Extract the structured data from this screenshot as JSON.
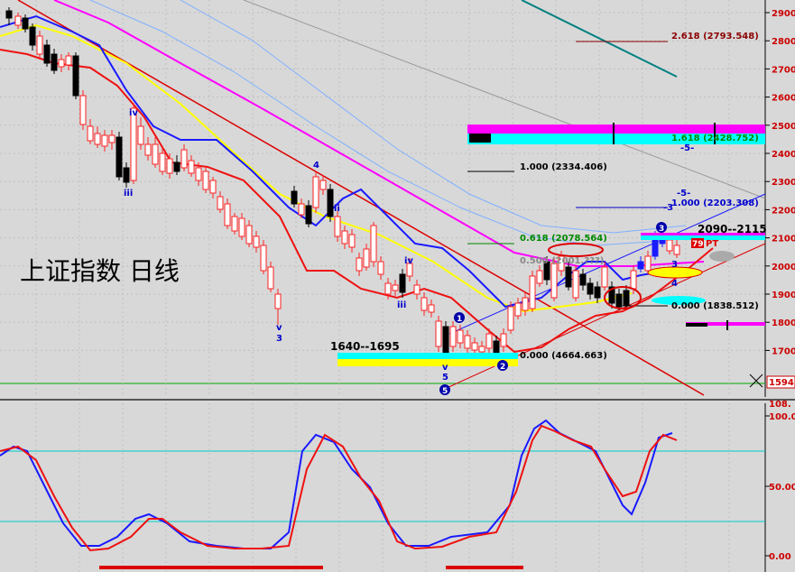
{
  "title": "上证指数 日线",
  "colors": {
    "bg": "#d8d8d8",
    "up": "#ff2020",
    "down": "#000000",
    "ma_blue": "#1a1aff",
    "ma_red": "#ee1111",
    "ma_magenta": "#ff00ff",
    "ma_yellow": "#ffff00",
    "osc_blue": "#1a1aff",
    "osc_red": "#ee1111"
  },
  "price_axis": {
    "ticks": [
      "2900.",
      "2800.",
      "2700.",
      "2600.",
      "2500.",
      "2400.",
      "2300.",
      "2200.",
      "2100.",
      "2000.",
      "1900.",
      "1800.",
      "1700."
    ],
    "last_value": "1594."
  },
  "osc_axis": {
    "ticks": [
      "100.0",
      "50.00",
      "0.00"
    ],
    "top_value": "108."
  },
  "fib_labels": [
    {
      "text": "2.618 (2793.548)",
      "color": "#8b0000"
    },
    {
      "text": "1.618 (2428.752)",
      "color": "#008800"
    },
    {
      "text": "1.000 (2334.406)",
      "color": "#000000"
    },
    {
      "text": "1.000 (2203.308)",
      "color": "#0000cc"
    },
    {
      "text": "0.618 (2078.564)",
      "color": "#008800"
    },
    {
      "text": "0.500 (2001.???)",
      "color": "#888888"
    },
    {
      "text": "0.000 (1838.512)",
      "color": "#000000"
    },
    {
      "text": "0.000 (4664.663)",
      "color": "#000000"
    }
  ],
  "annotations": {
    "range_low": "1640--1695",
    "range_high": "2090--2115",
    "pt_tag": "79",
    "pt_label": "PT",
    "minus5_a": "-5-",
    "minus5_b": "-5-",
    "minus3": "-3"
  },
  "wave_labels": [
    "iv",
    "iii",
    "4",
    "ii",
    "v",
    "3",
    "iv",
    "iii",
    "v",
    "5",
    "1",
    "2",
    "3",
    "5",
    "3",
    "4"
  ]
}
